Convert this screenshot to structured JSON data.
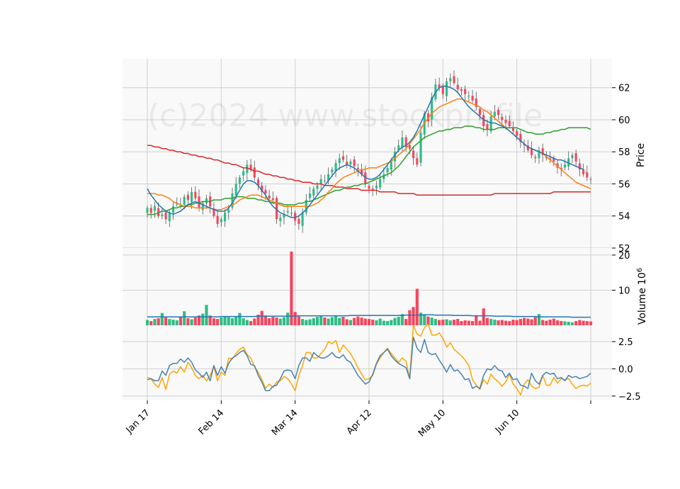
{
  "watermark": "(c)2024 www.stockprofile",
  "colors": {
    "up": "#2ebd85",
    "down": "#f6465d",
    "ma_fast": "#1f77b4",
    "ma_mid": "#ff7f0e",
    "ma_slow": "#2ca02c",
    "ma_long": "#d62728",
    "osc_a": "#4682b4",
    "osc_b": "#ffa500",
    "grid": "#d0d0d0",
    "panel_bg": "#f9f9f9"
  },
  "chart_data": [
    {
      "type": "candlestick",
      "panel": "price",
      "ylabel": "Price",
      "ylim": [
        52,
        63.8
      ],
      "yticks": [
        52,
        54,
        56,
        58,
        60,
        62
      ],
      "x_ticks": [
        {
          "label": "Jan 17",
          "index": 0
        },
        {
          "label": "Feb 14",
          "index": 20
        },
        {
          "label": "Mar 14",
          "index": 40
        },
        {
          "label": "Apr 12",
          "index": 60
        },
        {
          "label": "May 10",
          "index": 80
        },
        {
          "label": "Jun 10",
          "index": 100
        },
        {
          "label": "",
          "index": 120
        }
      ],
      "closes": [
        54.5,
        54.2,
        54.6,
        54.0,
        54.1,
        53.8,
        54.2,
        54.6,
        54.8,
        54.7,
        55.2,
        55.0,
        55.5,
        55.1,
        54.5,
        54.8,
        55.1,
        54.6,
        54.0,
        53.5,
        53.8,
        54.2,
        54.4,
        55.4,
        56.0,
        56.4,
        56.8,
        57.2,
        56.9,
        56.4,
        55.9,
        55.5,
        55.4,
        55.1,
        55.0,
        53.8,
        53.9,
        54.1,
        54.3,
        54.2,
        53.7,
        53.5,
        54.2,
        55.0,
        55.4,
        55.7,
        55.9,
        56.3,
        56.2,
        56.6,
        56.9,
        57.3,
        57.6,
        57.5,
        57.2,
        57.4,
        57.1,
        56.9,
        56.6,
        56.0,
        55.7,
        55.6,
        55.9,
        56.3,
        56.6,
        57.0,
        57.4,
        58.0,
        58.4,
        58.9,
        58.3,
        58.2,
        57.6,
        57.2,
        59.2,
        60.4,
        59.9,
        61.4,
        62.2,
        62.0,
        61.6,
        62.4,
        62.6,
        62.3,
        61.9,
        61.8,
        61.6,
        61.5,
        61.2,
        60.8,
        60.3,
        59.6,
        59.4,
        60.2,
        60.5,
        60.3,
        60.0,
        59.8,
        59.6,
        59.3,
        59.0,
        58.6,
        58.4,
        58.1,
        57.8,
        57.6,
        58.1,
        57.8,
        57.6,
        57.5,
        57.4,
        57.0,
        56.9,
        57.2,
        57.6,
        57.8,
        57.4,
        56.9,
        56.6,
        56.4,
        56.3
      ],
      "ma_fast": [
        55.7,
        55.3,
        55.0,
        54.7,
        54.5,
        54.3,
        54.2,
        54.1,
        54.2,
        54.3,
        54.5,
        54.7,
        54.8,
        54.9,
        54.8,
        54.7,
        54.6,
        54.5,
        54.4,
        54.3,
        54.3,
        54.3,
        54.5,
        54.8,
        55.2,
        55.6,
        56.0,
        56.2,
        56.2,
        56.1,
        55.9,
        55.6,
        55.3,
        54.9,
        54.6,
        54.4,
        54.2,
        54.1,
        54.0,
        53.9,
        53.9,
        54.0,
        54.2,
        54.4,
        54.7,
        55.0,
        55.3,
        55.6,
        55.9,
        56.2,
        56.5,
        56.8,
        57.0,
        57.1,
        57.2,
        57.1,
        57.0,
        56.8,
        56.6,
        56.4,
        56.3,
        56.3,
        56.4,
        56.6,
        56.9,
        57.2,
        57.5,
        57.8,
        58.1,
        58.3,
        58.4,
        58.6,
        58.9,
        59.3,
        59.8,
        60.3,
        60.8,
        61.3,
        61.7,
        62.0,
        62.1,
        62.1,
        62.0,
        61.9,
        61.7,
        61.4,
        61.1,
        60.8,
        60.6,
        60.4,
        60.2,
        60.0,
        59.9,
        59.8,
        59.8,
        59.7,
        59.6,
        59.5,
        59.3,
        59.1,
        58.9,
        58.7,
        58.5,
        58.3,
        58.2,
        58.1,
        58.0,
        57.9,
        57.8,
        57.7,
        57.6,
        57.5,
        57.5,
        57.4,
        57.3,
        57.2,
        57.1,
        57.0,
        56.9
      ],
      "ma_mid": [
        55.4,
        55.4,
        55.4,
        55.3,
        55.3,
        55.2,
        55.1,
        54.9,
        54.8,
        54.7,
        54.6,
        54.6,
        54.6,
        54.5,
        54.5,
        54.5,
        54.5,
        54.5,
        54.4,
        54.4,
        54.4,
        54.5,
        54.6,
        54.7,
        54.8,
        55.0,
        55.1,
        55.2,
        55.3,
        55.3,
        55.3,
        55.2,
        55.1,
        55.0,
        54.9,
        54.8,
        54.7,
        54.6,
        54.6,
        54.6,
        54.6,
        54.6,
        54.6,
        54.6,
        54.6,
        54.7,
        54.8,
        55.0,
        55.2,
        55.5,
        55.7,
        56.0,
        56.2,
        56.4,
        56.5,
        56.6,
        56.7,
        56.8,
        56.9,
        56.9,
        57.0,
        57.0,
        57.0,
        57.1,
        57.2,
        57.3,
        57.4,
        57.6,
        57.8,
        58.0,
        58.2,
        58.5,
        58.8,
        59.1,
        59.4,
        59.8,
        60.1,
        60.4,
        60.6,
        60.8,
        60.9,
        61.0,
        61.1,
        61.2,
        61.3,
        61.3,
        61.2,
        61.1,
        61.0,
        60.9,
        60.8,
        60.6,
        60.5,
        60.3,
        60.1,
        59.9,
        59.7,
        59.5,
        59.3,
        59.1,
        58.9,
        58.7,
        58.5,
        58.3,
        58.2,
        58.1,
        58.0,
        57.9,
        57.7,
        57.5,
        57.3,
        57.1,
        56.9,
        56.7,
        56.5,
        56.3,
        56.1,
        56.0,
        55.9,
        55.8,
        55.7
      ],
      "ma_slow": [
        54.1,
        54.1,
        54.1,
        54.2,
        54.3,
        54.3,
        54.4,
        54.5,
        54.5,
        54.6,
        54.6,
        54.7,
        54.7,
        54.8,
        54.8,
        54.9,
        54.9,
        54.9,
        55.0,
        55.0,
        55.0,
        55.1,
        55.1,
        55.1,
        55.2,
        55.2,
        55.2,
        55.1,
        55.1,
        55.1,
        55.0,
        55.0,
        54.9,
        54.9,
        54.8,
        54.8,
        54.8,
        54.7,
        54.7,
        54.7,
        54.7,
        54.8,
        54.8,
        54.9,
        54.9,
        55.0,
        55.1,
        55.2,
        55.3,
        55.4,
        55.5,
        55.6,
        55.6,
        55.7,
        55.8,
        55.8,
        55.9,
        55.9,
        56.0,
        56.0,
        56.1,
        56.2,
        56.3,
        56.4,
        56.5,
        56.6,
        56.7,
        56.9,
        57.1,
        57.4,
        57.7,
        58.0,
        58.3,
        58.5,
        58.7,
        58.9,
        59.0,
        59.1,
        59.2,
        59.3,
        59.3,
        59.4,
        59.4,
        59.5,
        59.5,
        59.5,
        59.6,
        59.6,
        59.6,
        59.5,
        59.5,
        59.4,
        59.4,
        59.4,
        59.4,
        59.5,
        59.5,
        59.5,
        59.5,
        59.5,
        59.5,
        59.4,
        59.3,
        59.2,
        59.2,
        59.1,
        59.1,
        59.1,
        59.2,
        59.2,
        59.3,
        59.3,
        59.4,
        59.4,
        59.5,
        59.5,
        59.5,
        59.5,
        59.5,
        59.5,
        59.4
      ],
      "ma_long": [
        58.4,
        58.4,
        58.3,
        58.3,
        58.2,
        58.2,
        58.1,
        58.1,
        58.0,
        58.0,
        57.9,
        57.9,
        57.8,
        57.8,
        57.7,
        57.7,
        57.6,
        57.6,
        57.5,
        57.5,
        57.4,
        57.3,
        57.3,
        57.2,
        57.2,
        57.1,
        57.0,
        57.0,
        56.9,
        56.8,
        56.8,
        56.7,
        56.6,
        56.6,
        56.5,
        56.5,
        56.4,
        56.4,
        56.3,
        56.3,
        56.2,
        56.2,
        56.1,
        56.1,
        56.1,
        56.0,
        56.0,
        56.0,
        55.9,
        55.9,
        55.9,
        55.8,
        55.8,
        55.8,
        55.7,
        55.7,
        55.7,
        55.7,
        55.6,
        55.6,
        55.6,
        55.6,
        55.6,
        55.5,
        55.5,
        55.5,
        55.5,
        55.5,
        55.4,
        55.4,
        55.4,
        55.4,
        55.4,
        55.3,
        55.3,
        55.3,
        55.3,
        55.3,
        55.3,
        55.3,
        55.3,
        55.3,
        55.3,
        55.3,
        55.3,
        55.3,
        55.3,
        55.3,
        55.3,
        55.3,
        55.3,
        55.3,
        55.3,
        55.3,
        55.4,
        55.4,
        55.4,
        55.4,
        55.4,
        55.4,
        55.4,
        55.4,
        55.4,
        55.4,
        55.4,
        55.4,
        55.4,
        55.4,
        55.4,
        55.4,
        55.5,
        55.5,
        55.5,
        55.5,
        55.5,
        55.5,
        55.5,
        55.5,
        55.5,
        55.5,
        55.5
      ]
    },
    {
      "type": "bar",
      "panel": "volume",
      "ylabel": "Volume",
      "ylabel_multiplier": "10^6",
      "ylim": [
        0,
        22
      ],
      "yticks": [
        10,
        20
      ],
      "values": [
        1.5,
        1.2,
        1.8,
        2.0,
        3.5,
        2.2,
        1.8,
        1.6,
        1.4,
        2.4,
        4.0,
        2.0,
        1.7,
        2.2,
        2.8,
        3.3,
        5.8,
        2.8,
        2.0,
        1.8,
        2.2,
        2.6,
        2.3,
        2.0,
        2.4,
        3.5,
        2.0,
        1.5,
        1.2,
        1.9,
        3.0,
        4.1,
        2.8,
        2.0,
        2.4,
        2.2,
        1.9,
        2.3,
        3.6,
        21.0,
        3.8,
        2.5,
        1.8,
        1.5,
        1.7,
        2.0,
        2.4,
        2.8,
        2.2,
        1.9,
        2.3,
        2.6,
        2.1,
        2.4,
        1.7,
        1.5,
        2.1,
        2.5,
        2.2,
        1.9,
        1.8,
        1.6,
        1.4,
        1.9,
        1.3,
        1.2,
        1.5,
        2.1,
        2.4,
        3.2,
        1.8,
        4.3,
        5.2,
        10.4,
        3.6,
        2.9,
        2.5,
        2.2,
        1.8,
        1.5,
        1.6,
        1.7,
        1.4,
        1.6,
        1.8,
        1.2,
        1.4,
        1.3,
        1.2,
        2.8,
        1.3,
        4.8,
        2.1,
        1.8,
        1.6,
        1.4,
        1.5,
        1.3,
        1.2,
        1.6,
        1.5,
        1.8,
        2.1,
        1.9,
        1.7,
        2.3,
        3.2,
        1.5,
        1.3,
        1.6,
        1.9,
        1.4,
        1.2,
        1.1,
        1.0,
        0.8,
        1.2,
        1.5,
        1.3,
        1.2,
        1.1
      ],
      "avg": [
        2.4,
        2.4,
        2.4,
        2.4,
        2.4,
        2.4,
        2.4,
        2.4,
        2.4,
        2.4,
        2.4,
        2.4,
        2.4,
        2.4,
        2.4,
        2.4,
        2.4,
        2.4,
        2.4,
        2.4,
        2.5,
        2.5,
        2.5,
        2.5,
        2.5,
        2.5,
        2.5,
        2.5,
        2.5,
        2.5,
        2.6,
        2.6,
        2.6,
        2.6,
        2.6,
        2.6,
        2.6,
        2.6,
        2.6,
        2.6,
        2.6,
        2.7,
        2.7,
        2.7,
        2.7,
        2.7,
        2.7,
        2.7,
        2.7,
        2.7,
        2.7,
        2.7,
        2.7,
        2.7,
        2.7,
        2.8,
        2.8,
        2.8,
        2.8,
        2.8,
        2.8,
        2.8,
        2.8,
        2.8,
        2.8,
        2.8,
        2.8,
        2.8,
        2.8,
        2.8,
        2.9,
        2.9,
        2.9,
        2.9,
        2.9,
        3.0,
        3.0,
        3.0,
        2.9,
        2.9,
        2.9,
        2.9,
        2.9,
        2.8,
        2.8,
        2.8,
        2.8,
        2.8,
        2.7,
        2.7,
        2.7,
        2.7,
        2.7,
        2.7,
        2.6,
        2.6,
        2.6,
        2.6,
        2.6,
        2.5,
        2.5,
        2.5,
        2.5,
        2.5,
        2.5,
        2.5,
        2.4,
        2.4,
        2.4,
        2.4,
        2.4,
        2.4,
        2.4,
        2.4,
        2.4,
        2.3,
        2.3,
        2.3,
        2.3,
        2.3,
        2.3
      ]
    },
    {
      "type": "line",
      "panel": "oscillator",
      "ylim": [
        -2.9,
        4.0
      ],
      "yticks": [
        -2.5,
        0.0,
        2.5
      ],
      "series_a": [
        -1.0,
        -0.9,
        -1.1,
        -1.1,
        -0.2,
        -0.6,
        0.3,
        0.5,
        0.5,
        0.9,
        0.6,
        1.0,
        0.6,
        -0.1,
        -0.4,
        -0.8,
        -0.3,
        -1.1,
        0.3,
        -0.6,
        0.2,
        -0.4,
        0.5,
        1.0,
        1.2,
        1.5,
        1.7,
        1.2,
        0.4,
        0.3,
        -0.6,
        -1.2,
        -2.0,
        -2.0,
        -1.6,
        -1.5,
        -0.9,
        -0.2,
        -0.1,
        -0.2,
        -0.9,
        0.3,
        1.0,
        1.0,
        0.7,
        1.5,
        1.2,
        1.0,
        1.0,
        1.2,
        1.5,
        1.1,
        1.0,
        1.3,
        0.8,
        0.6,
        0.0,
        -0.6,
        -1.0,
        -1.4,
        -1.2,
        -0.5,
        0.5,
        1.2,
        1.5,
        1.8,
        1.2,
        0.8,
        0.5,
        0.3,
        0.1,
        -0.9,
        2.9,
        1.9,
        1.5,
        2.7,
        1.5,
        1.3,
        1.4,
        0.8,
        0.3,
        -0.3,
        0.4,
        -0.2,
        -0.1,
        -0.5,
        -1.0,
        -0.9,
        -1.8,
        -1.6,
        -1.8,
        -0.6,
        0.0,
        -0.1,
        0.3,
        -0.1,
        -0.2,
        -0.8,
        -0.4,
        -1.0,
        -0.9,
        -1.5,
        -1.6,
        -1.8,
        -0.4,
        -1.1,
        -1.4,
        -0.6,
        -0.3,
        -0.5,
        -0.4,
        -0.9,
        -0.8,
        -1.1,
        -0.6,
        -0.8,
        -0.7,
        -0.9,
        -0.8,
        -0.7,
        -0.4
      ],
      "series_b": [
        -0.8,
        -0.9,
        -1.4,
        -1.7,
        -0.8,
        -1.9,
        -0.5,
        -0.2,
        -0.4,
        0.2,
        -0.3,
        0.6,
        0.1,
        -0.6,
        -0.9,
        -0.6,
        -1.1,
        -0.6,
        0.2,
        -1.1,
        -0.3,
        -0.6,
        1.0,
        0.9,
        1.4,
        1.8,
        2.0,
        1.3,
        1.0,
        0.2,
        -0.3,
        -1.0,
        -1.8,
        -1.4,
        -1.7,
        -1.2,
        -1.1,
        -0.7,
        -0.9,
        -1.4,
        -2.0,
        -0.6,
        0.3,
        1.5,
        1.5,
        1.0,
        1.0,
        1.4,
        1.8,
        2.5,
        2.3,
        2.6,
        1.5,
        2.2,
        1.8,
        1.4,
        0.8,
        0.1,
        -0.5,
        -1.0,
        -0.9,
        -0.6,
        0.4,
        1.0,
        1.5,
        1.9,
        1.4,
        1.0,
        0.6,
        1.0,
        0.7,
        -0.9,
        4.0,
        3.2,
        3.0,
        3.8,
        4.1,
        3.1,
        3.1,
        3.3,
        2.8,
        2.0,
        2.4,
        1.8,
        1.5,
        1.2,
        0.8,
        0.3,
        -1.0,
        -1.5,
        -1.9,
        -1.0,
        -1.4,
        -0.5,
        -0.9,
        -1.2,
        -1.6,
        -1.2,
        -0.5,
        -1.4,
        -1.8,
        -2.4,
        -1.4,
        -1.0,
        -1.6,
        -1.8,
        -1.7,
        -0.6,
        -1.5,
        -1.5,
        -0.8,
        -1.3,
        -0.9,
        -1.0,
        -0.9,
        -1.4,
        -1.8,
        -1.6,
        -1.5,
        -1.6,
        -1.3
      ]
    }
  ]
}
